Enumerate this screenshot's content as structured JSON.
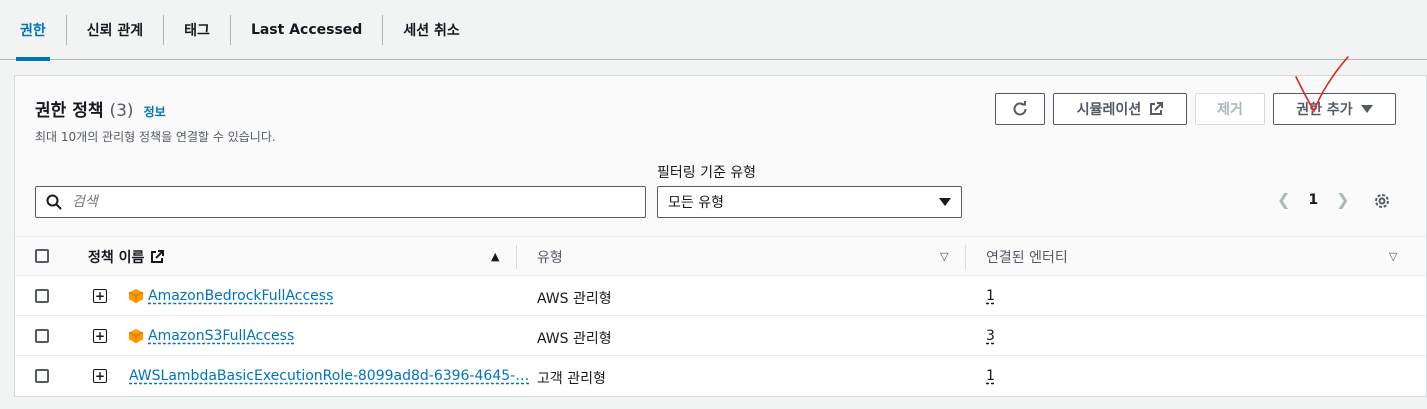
{
  "tabs": [
    {
      "label": "권한",
      "active": true
    },
    {
      "label": "신뢰 관계",
      "active": false
    },
    {
      "label": "태그",
      "active": false
    },
    {
      "label": "Last Accessed",
      "active": false
    },
    {
      "label": "세션 취소",
      "active": false
    }
  ],
  "panel": {
    "title": "권한 정책",
    "count": "(3)",
    "info_link": "정보",
    "description": "최대 10개의 관리형 정책을 연결할 수 있습니다.",
    "buttons": {
      "refresh_icon": "refresh-icon",
      "simulation": "시뮬레이션",
      "remove": "제거",
      "add_permissions": "권한 추가"
    },
    "filter_label": "필터링 기준 유형",
    "search_placeholder": "검색",
    "filter_select_value": "모든 유형",
    "pagination": {
      "current_page": "1"
    }
  },
  "table": {
    "columns": [
      "정책 이름",
      "유형",
      "연결된 엔터티"
    ],
    "rows": [
      {
        "name": "AmazonBedrockFullAccess",
        "type": "AWS 관리형",
        "entities": "1",
        "aws_managed": true
      },
      {
        "name": "AmazonS3FullAccess",
        "type": "AWS 관리형",
        "entities": "3",
        "aws_managed": true
      },
      {
        "name": "AWSLambdaBasicExecutionRole-8099ad8d-6396-4645-…",
        "type": "고객 관리형",
        "entities": "1",
        "aws_managed": false
      }
    ]
  },
  "colors": {
    "accent": "#0073bb",
    "aws_orange": "#ff9900",
    "annotation_red": "#e02020"
  }
}
